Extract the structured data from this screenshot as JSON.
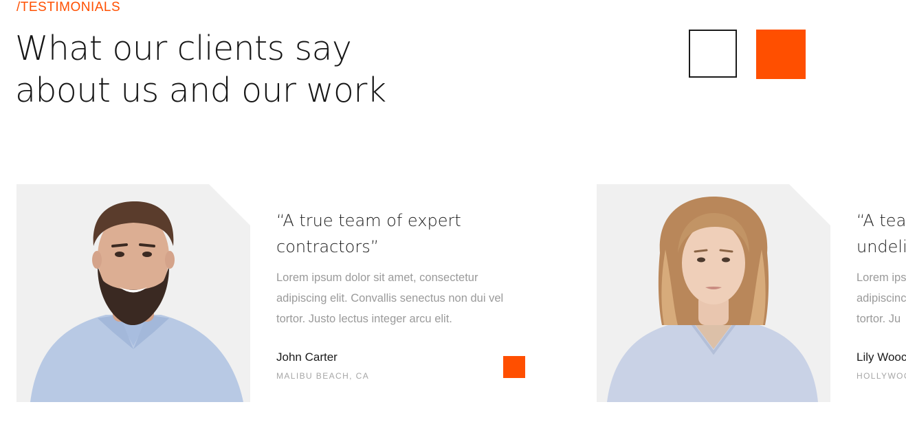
{
  "section": {
    "eyebrow": "/TESTIMONIALS",
    "title_line1": "What our clients say",
    "title_line2": "about us and our work"
  },
  "colors": {
    "accent": "#ff4f00",
    "card_bg": "#f0f0f0",
    "text": "#1a1a1a",
    "muted": "#9a9a9a"
  },
  "navigation": {
    "prev_icon": "prev-arrow-icon",
    "next_icon": "next-arrow-icon"
  },
  "testimonials": [
    {
      "quote_line1": "“A true team of expert",
      "quote_line2": "contractors”",
      "body_line1": "Lorem ipsum dolor sit amet, consectetur",
      "body_line2": "adipiscing elit. Convallis senectus non dui vel",
      "body_line3": "tortor. Justo lectus integer arcu elit.",
      "author": "John Carter",
      "location": "MALIBU BEACH, CA"
    },
    {
      "quote_line1": "“A tear",
      "quote_line2": "undeli",
      "body_line1": "Lorem ips",
      "body_line2": "adipiscinc",
      "body_line3": "tortor. Ju",
      "author": "Lily Wooc",
      "location": "HOLLYWOO"
    }
  ]
}
